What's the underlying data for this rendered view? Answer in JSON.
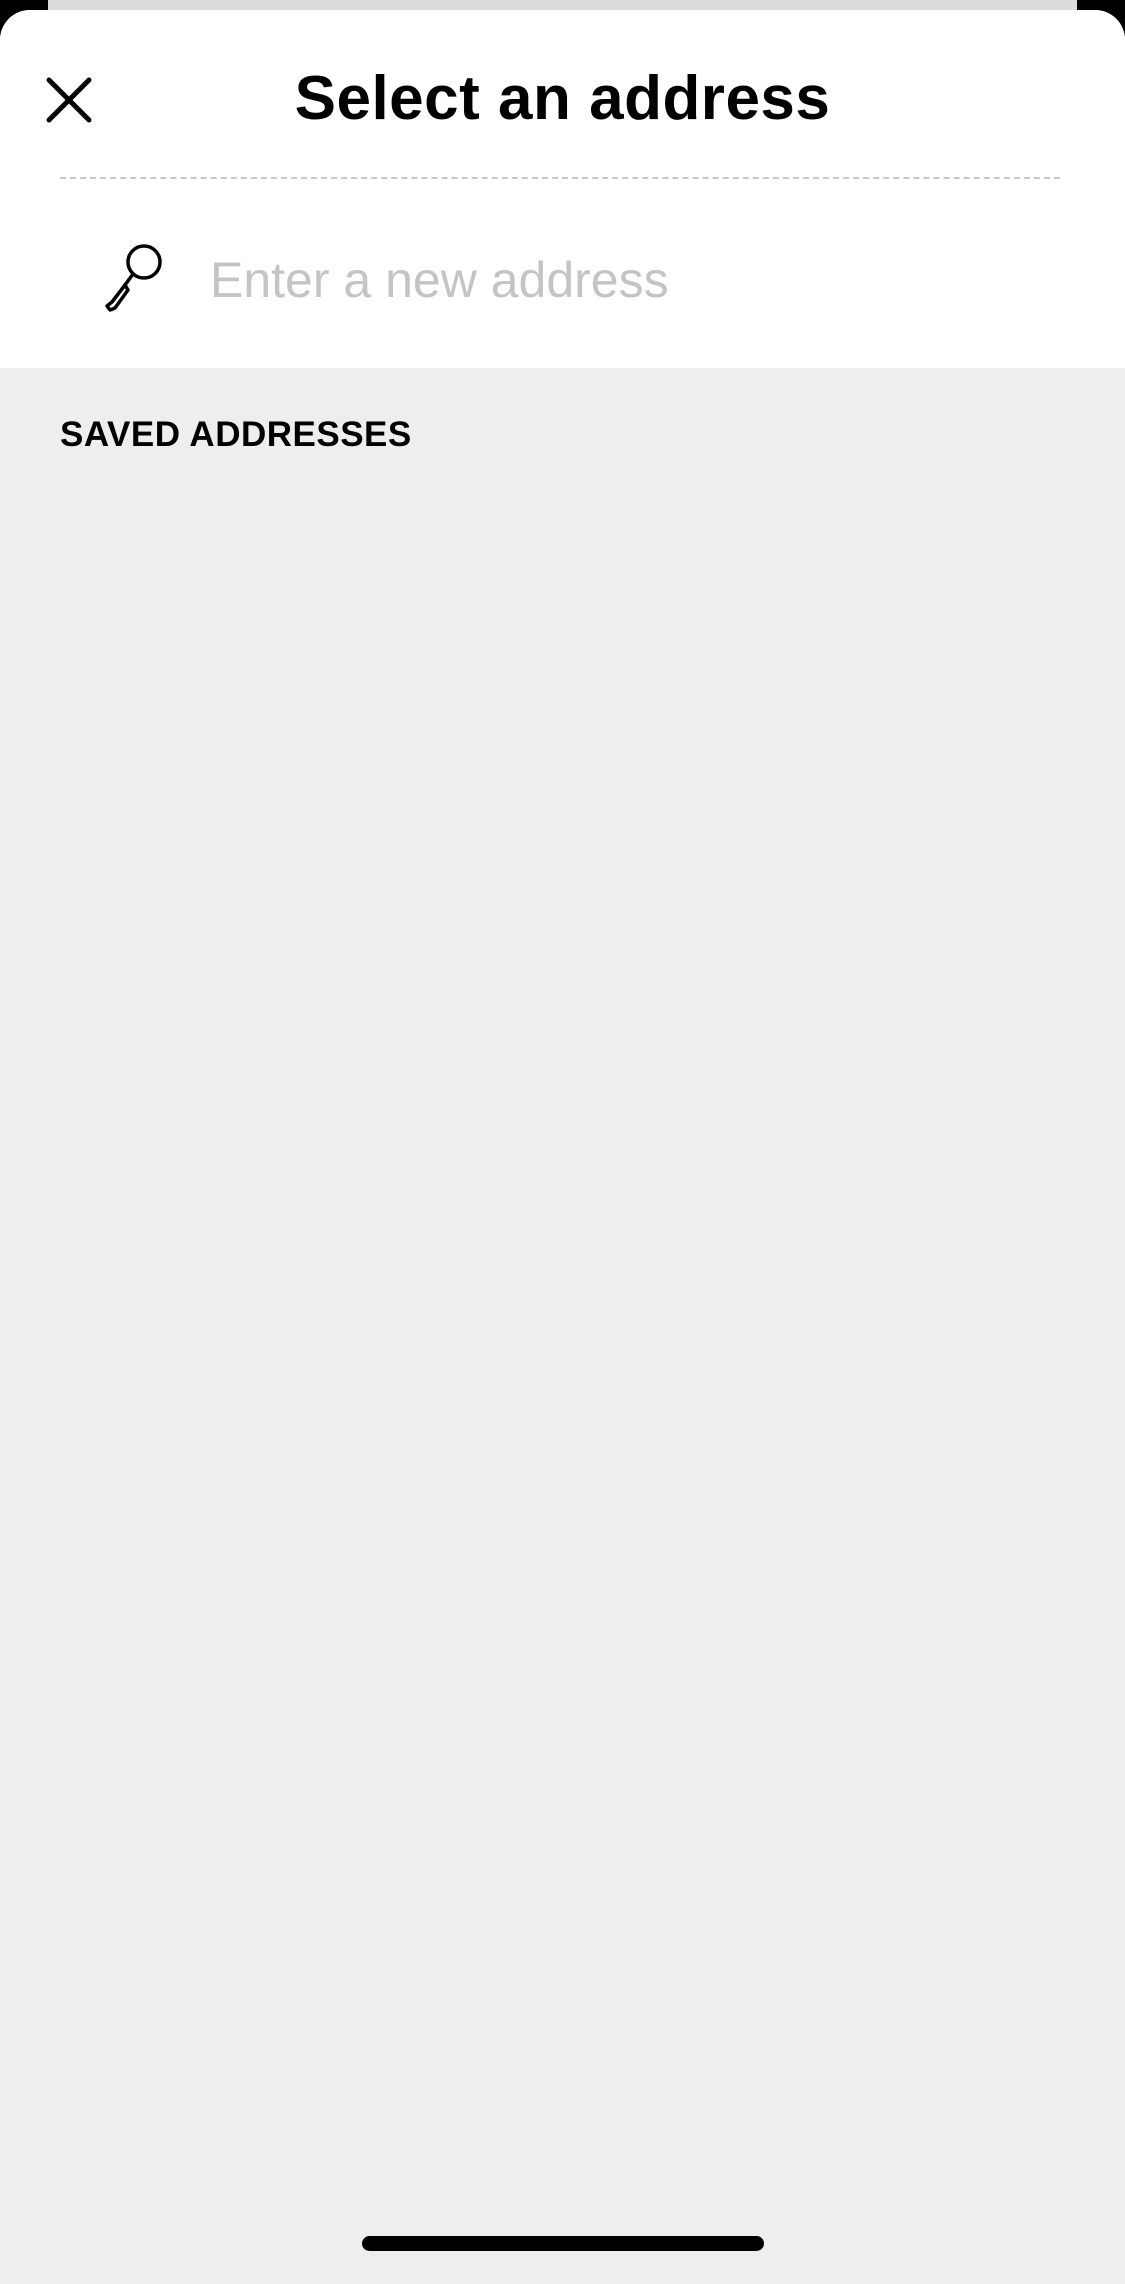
{
  "header": {
    "title": "Select an address",
    "close_icon": "close-icon"
  },
  "search": {
    "placeholder": "Enter a new address",
    "value": "",
    "icon": "search-icon"
  },
  "saved": {
    "section_label": "SAVED ADDRESSES",
    "items": []
  },
  "colors": {
    "sheet_background": "#eeeeee",
    "header_background": "#ffffff",
    "text": "#000000",
    "placeholder": "#c4c4c4",
    "divider": "#c8c8c8"
  }
}
